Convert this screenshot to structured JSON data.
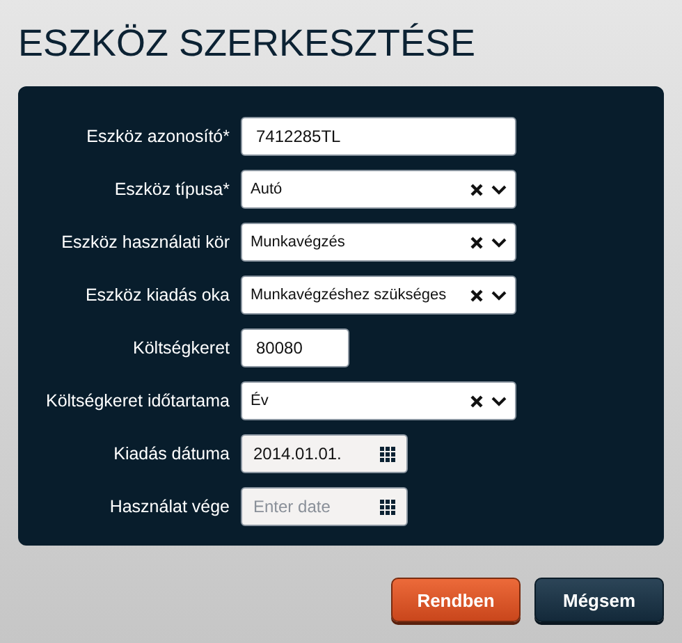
{
  "title": "ESZKÖZ SZERKESZTÉSE",
  "fields": [
    {
      "label": "Eszköz azonosító*",
      "kind": "text",
      "value": "7412285TL"
    },
    {
      "label": "Eszköz típusa*",
      "kind": "select",
      "value": "Autó"
    },
    {
      "label": "Eszköz használati kör",
      "kind": "select",
      "value": "Munkavégzés"
    },
    {
      "label": "Eszköz kiadás oka",
      "kind": "select",
      "value": "Munkavégzéshez szükséges"
    },
    {
      "label": "Költségkeret",
      "kind": "number",
      "value": "80080"
    },
    {
      "label": "Költségkeret időtartama",
      "kind": "select",
      "value": "Év"
    },
    {
      "label": "Kiadás dátuma",
      "kind": "date",
      "value": "2014.01.01."
    },
    {
      "label": "Használat vége",
      "kind": "date",
      "placeholder": "Enter date"
    }
  ],
  "buttons": [
    {
      "label": "Rendben",
      "kind": "primary"
    },
    {
      "label": "Mégsem",
      "kind": "secondary"
    }
  ]
}
